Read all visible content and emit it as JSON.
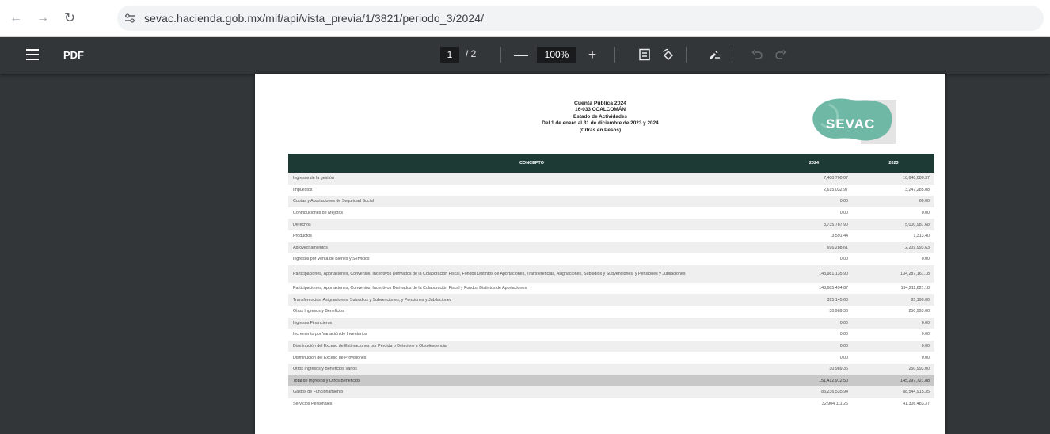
{
  "browser": {
    "url": "sevac.hacienda.gob.mx/mif/api/vista_previa/1/3821/periodo_3/2024/"
  },
  "toolbar": {
    "title": "PDF",
    "page_current": "1",
    "page_total": "/ 2",
    "zoom": "100%"
  },
  "document": {
    "header_lines": [
      "Cuenta Pública 2024",
      "16-033 COALCOMÁN",
      "Estado de Actividades",
      "Del 1 de enero al 31 de diciembre de 2023 y 2024",
      "(Cifras en Pesos)"
    ],
    "logo_text": "SEVAC",
    "columns": [
      "CONCEPTO",
      "2024",
      "2023"
    ],
    "rows": [
      {
        "concept": "Ingresos de la gestión",
        "v2024": "7,400,700.07",
        "v2023": "10,640,080.37"
      },
      {
        "concept": "Impuestos",
        "v2024": "2,615,032.97",
        "v2023": "3,247,285.08"
      },
      {
        "concept": "Cuotas y Aportaciones de Seguridad Social",
        "v2024": "0.00",
        "v2023": "60.00"
      },
      {
        "concept": "Contribuciones de Mejoras",
        "v2024": "0.00",
        "v2023": "0.00"
      },
      {
        "concept": "Derechos",
        "v2024": "3,735,787.90",
        "v2023": "5,000,987.68"
      },
      {
        "concept": "Productos",
        "v2024": "3,591.44",
        "v2023": "1,313.40"
      },
      {
        "concept": "Aprovechamientos",
        "v2024": "696,288.61",
        "v2023": "2,209,993.63"
      },
      {
        "concept": "Ingresos por Venta de Bienes y Servicios",
        "v2024": "0.00",
        "v2023": "0.00"
      },
      {
        "concept": "Participaciones, Aportaciones, Convenios, Incentivos Derivados de la Colaboración Fiscal, Fondos Distintos de Aportaciones, Transferencias, Asignaciones, Subsidios y Subvenciones, y Pensiones y Jubilaciones",
        "v2024": "143,981,135.90",
        "v2023": "134,287,161.18",
        "tall": true
      },
      {
        "concept": "Participaciones, Aportaciones, Convenios, Incentivos Derivados de la Colaboración Fiscal y Fondos Distintos de Aportaciones",
        "v2024": "143,685,494.87",
        "v2023": "134,211,621.18"
      },
      {
        "concept": "Transferencias, Asignaciones, Subsidios y Subvenciones, y Pensiones y Jubilaciones",
        "v2024": "395,145.63",
        "v2023": "85,190.00"
      },
      {
        "concept": "Otros Ingresos y Beneficios",
        "v2024": "30,989.36",
        "v2023": "250,993.00"
      },
      {
        "concept": "Ingresos Financieros",
        "v2024": "0.00",
        "v2023": "0.00"
      },
      {
        "concept": "Incremento por Variación de Inventarios",
        "v2024": "0.00",
        "v2023": "0.00"
      },
      {
        "concept": "Disminución del Exceso de Estimaciones por Pérdida o Deterioro u Obsolescencia",
        "v2024": "0.00",
        "v2023": "0.00"
      },
      {
        "concept": "Disminución del Exceso de Provisiones",
        "v2024": "0.00",
        "v2023": "0.00"
      },
      {
        "concept": "Otros Ingresos y Beneficios Varios",
        "v2024": "30,989.36",
        "v2023": "250,993.00"
      },
      {
        "concept": "Total de Ingresos y Otros Beneficios",
        "v2024": "151,412,912.50",
        "v2023": "145,297,721.88",
        "total": true
      },
      {
        "concept": "Gastos de Funcionamiento",
        "v2024": "83,236,535.94",
        "v2023": "88,544,915.35"
      },
      {
        "concept": "Servicios Personales",
        "v2024": "32,904,111.26",
        "v2023": "41,306,483.37"
      }
    ]
  },
  "colors": {
    "toolbar": "#323639",
    "table_header": "#1d3b34",
    "logo_teal": "#6fb8a6"
  },
  "icons": [
    "back-arrow-icon",
    "forward-arrow-icon",
    "reload-icon",
    "site-info-icon",
    "menu-icon",
    "zoom-out-icon",
    "zoom-in-icon",
    "fit-page-icon",
    "rotate-icon",
    "annotate-icon",
    "undo-icon",
    "redo-icon"
  ]
}
